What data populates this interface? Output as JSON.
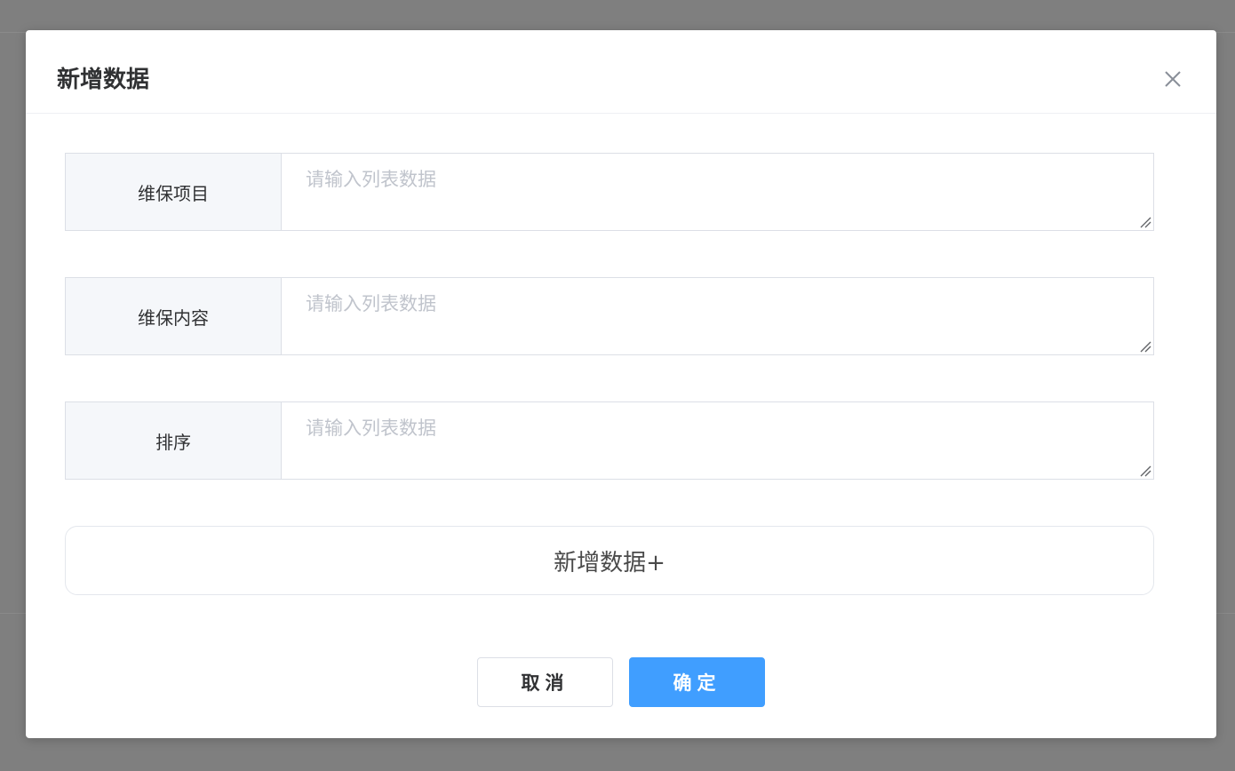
{
  "dialog": {
    "title": "新增数据",
    "close_icon": "close-icon"
  },
  "form": {
    "rows": [
      {
        "label": "维保项目",
        "placeholder": "请输入列表数据",
        "value": ""
      },
      {
        "label": "维保内容",
        "placeholder": "请输入列表数据",
        "value": ""
      },
      {
        "label": "排序",
        "placeholder": "请输入列表数据",
        "value": ""
      }
    ],
    "add_row_label": "新增数据+"
  },
  "footer": {
    "cancel_label": "取消",
    "confirm_label": "确定"
  },
  "colors": {
    "overlay": "#7f7f7f",
    "primary": "#409eff",
    "label_bg": "#f5f7fa",
    "border": "#dcdfe6",
    "placeholder": "#c0c4cc"
  }
}
